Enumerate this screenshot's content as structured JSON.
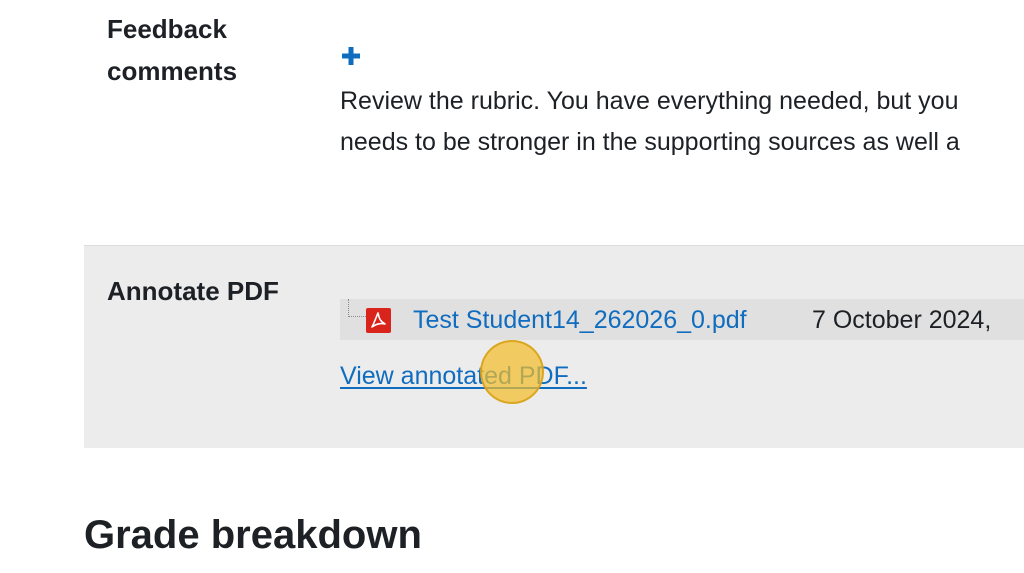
{
  "feedback": {
    "label": "Feedback comments",
    "expand_icon": "plus-icon",
    "lines": [
      "Review the rubric. You have everything needed, but you",
      "needs to be stronger in the supporting sources as well a"
    ]
  },
  "annotate": {
    "label": "Annotate PDF",
    "file": {
      "icon": "pdf-file-icon",
      "name": "Test Student14_262026_0.pdf",
      "date": "7 October 2024,"
    },
    "view_link": "View annotated PDF..."
  },
  "grade": {
    "heading": "Grade breakdown"
  },
  "colors": {
    "link": "#0f6cbf",
    "section_bg": "#ececec",
    "file_row_bg": "#e0e0e0",
    "pdf_red": "#d9241c",
    "cursor_highlight": "#f3be2d"
  }
}
